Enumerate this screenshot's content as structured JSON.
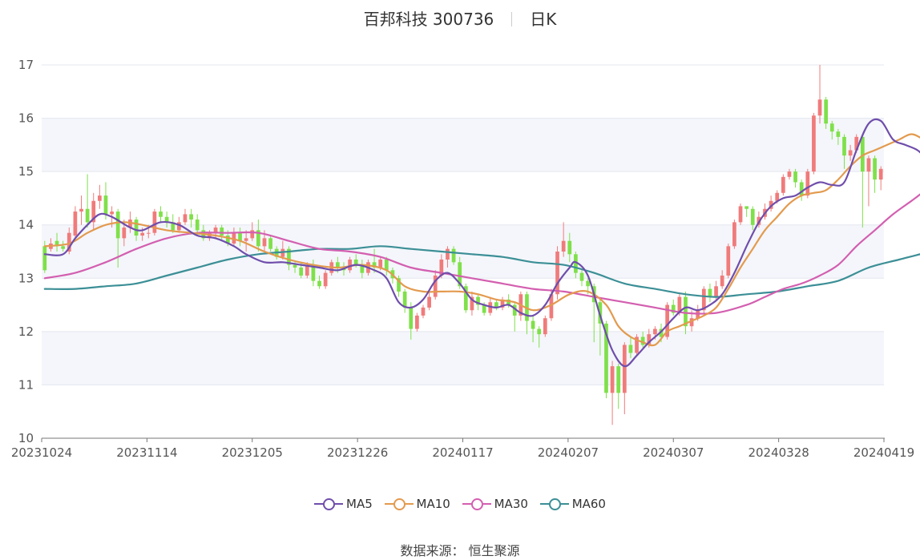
{
  "header": {
    "title": "百邦科技 300736",
    "period": "日K"
  },
  "footer": {
    "source": "数据来源： 恒生聚源"
  },
  "colors": {
    "up": "#f07b7b",
    "down": "#7fe04a",
    "grid": "#e3e7ef",
    "band": "#f4f6fb",
    "ma5": "#6f4eab",
    "ma10": "#e39a4e",
    "ma30": "#d35fb0",
    "ma60": "#3c8f96"
  },
  "chart_data": {
    "type": "candlestick",
    "ylim": [
      10,
      17
    ],
    "yticks": [
      "10",
      "11",
      "12",
      "13",
      "14",
      "15",
      "16",
      "17"
    ],
    "xtick_labels": [
      "20231024",
      "20231114",
      "20231205",
      "20231226",
      "20240117",
      "20240207",
      "20240307",
      "20240328",
      "20240419"
    ],
    "legend": [
      "MA5",
      "MA10",
      "MA30",
      "MA60"
    ],
    "candles": [
      [
        13.6,
        13.15,
        13.7,
        13.1
      ],
      [
        13.55,
        13.65,
        13.75,
        13.5
      ],
      [
        13.7,
        13.6,
        13.85,
        13.5
      ],
      [
        13.6,
        13.55,
        13.7,
        13.5
      ],
      [
        13.5,
        13.85,
        13.95,
        13.45
      ],
      [
        13.8,
        14.25,
        14.35,
        13.7
      ],
      [
        14.25,
        14.3,
        14.55,
        14.0
      ],
      [
        14.3,
        14.05,
        14.95,
        13.95
      ],
      [
        14.05,
        14.45,
        14.6,
        13.9
      ],
      [
        14.45,
        14.55,
        14.75,
        14.3
      ],
      [
        14.55,
        14.2,
        14.8,
        14.1
      ],
      [
        14.2,
        14.25,
        14.35,
        13.95
      ],
      [
        14.25,
        13.75,
        14.3,
        13.2
      ],
      [
        13.75,
        13.95,
        14.1,
        13.6
      ],
      [
        13.95,
        14.1,
        14.25,
        13.85
      ],
      [
        14.1,
        13.8,
        14.15,
        13.7
      ],
      [
        13.8,
        13.85,
        13.95,
        13.7
      ],
      [
        13.85,
        13.85,
        14.0,
        13.75
      ],
      [
        13.85,
        14.25,
        14.3,
        13.8
      ],
      [
        14.25,
        14.15,
        14.35,
        14.05
      ],
      [
        14.15,
        14.05,
        14.25,
        13.95
      ],
      [
        14.05,
        13.9,
        14.2,
        13.85
      ],
      [
        13.9,
        14.05,
        14.15,
        13.85
      ],
      [
        14.05,
        14.2,
        14.3,
        14.0
      ],
      [
        14.2,
        14.1,
        14.3,
        13.95
      ],
      [
        14.1,
        13.9,
        14.2,
        13.8
      ],
      [
        13.9,
        13.75,
        14.0,
        13.7
      ],
      [
        13.75,
        13.85,
        13.9,
        13.7
      ],
      [
        13.85,
        13.95,
        14.0,
        13.75
      ],
      [
        13.95,
        13.8,
        14.0,
        13.7
      ],
      [
        13.8,
        13.65,
        13.9,
        13.6
      ],
      [
        13.65,
        13.85,
        13.95,
        13.6
      ],
      [
        13.85,
        13.7,
        13.95,
        13.6
      ],
      [
        13.7,
        13.75,
        13.9,
        13.5
      ],
      [
        13.75,
        13.9,
        14.05,
        13.7
      ],
      [
        13.9,
        13.6,
        14.1,
        13.5
      ],
      [
        13.6,
        13.75,
        13.9,
        13.5
      ],
      [
        13.75,
        13.55,
        13.8,
        13.5
      ],
      [
        13.55,
        13.4,
        13.6,
        13.35
      ],
      [
        13.4,
        13.55,
        13.7,
        13.35
      ],
      [
        13.55,
        13.25,
        13.6,
        13.15
      ],
      [
        13.25,
        13.2,
        13.3,
        13.1
      ],
      [
        13.2,
        13.05,
        13.3,
        13.0
      ],
      [
        13.05,
        13.25,
        13.3,
        13.0
      ],
      [
        13.25,
        12.95,
        13.35,
        12.85
      ],
      [
        12.95,
        12.85,
        13.05,
        12.8
      ],
      [
        12.85,
        13.1,
        13.15,
        12.8
      ],
      [
        13.1,
        13.3,
        13.35,
        13.05
      ],
      [
        13.3,
        13.2,
        13.4,
        13.1
      ],
      [
        13.2,
        13.15,
        13.3,
        13.05
      ],
      [
        13.15,
        13.35,
        13.4,
        13.1
      ],
      [
        13.35,
        13.25,
        13.45,
        13.2
      ],
      [
        13.25,
        13.1,
        13.35,
        13.0
      ],
      [
        13.1,
        13.3,
        13.35,
        13.05
      ],
      [
        13.3,
        13.2,
        13.55,
        13.1
      ],
      [
        13.2,
        13.35,
        13.4,
        13.15
      ],
      [
        13.35,
        13.15,
        13.4,
        13.05
      ],
      [
        13.15,
        13.0,
        13.2,
        12.9
      ],
      [
        13.0,
        12.75,
        13.05,
        12.65
      ],
      [
        12.75,
        12.45,
        12.8,
        12.35
      ],
      [
        12.45,
        12.05,
        12.55,
        11.85
      ],
      [
        12.05,
        12.3,
        12.35,
        12.0
      ],
      [
        12.3,
        12.45,
        12.5,
        12.25
      ],
      [
        12.45,
        12.65,
        12.8,
        12.4
      ],
      [
        12.65,
        13.05,
        13.15,
        12.6
      ],
      [
        13.05,
        13.35,
        13.45,
        13.0
      ],
      [
        13.35,
        13.55,
        13.6,
        13.2
      ],
      [
        13.55,
        13.3,
        13.6,
        13.25
      ],
      [
        13.3,
        12.85,
        13.4,
        12.8
      ],
      [
        12.85,
        12.4,
        12.9,
        12.35
      ],
      [
        12.4,
        12.65,
        12.75,
        12.3
      ],
      [
        12.65,
        12.5,
        12.7,
        12.4
      ],
      [
        12.5,
        12.35,
        12.55,
        12.3
      ],
      [
        12.35,
        12.55,
        12.65,
        12.3
      ],
      [
        12.55,
        12.45,
        12.6,
        12.4
      ],
      [
        12.45,
        12.6,
        12.65,
        12.4
      ],
      [
        12.6,
        12.5,
        12.7,
        12.45
      ],
      [
        12.5,
        12.3,
        12.55,
        12.0
      ],
      [
        12.3,
        12.7,
        12.75,
        12.2
      ],
      [
        12.7,
        12.2,
        12.75,
        11.95
      ],
      [
        12.2,
        12.05,
        12.3,
        11.8
      ],
      [
        12.05,
        11.95,
        12.1,
        11.7
      ],
      [
        11.95,
        12.25,
        12.3,
        11.9
      ],
      [
        12.25,
        12.7,
        12.8,
        12.2
      ],
      [
        12.7,
        13.5,
        13.6,
        12.6
      ],
      [
        13.5,
        13.7,
        14.05,
        13.4
      ],
      [
        13.7,
        13.45,
        13.85,
        13.3
      ],
      [
        13.45,
        13.1,
        13.5,
        13.0
      ],
      [
        13.1,
        12.95,
        13.15,
        12.85
      ],
      [
        12.95,
        12.85,
        13.0,
        12.7
      ],
      [
        12.85,
        12.55,
        12.9,
        11.8
      ],
      [
        12.55,
        12.15,
        12.6,
        11.55
      ],
      [
        12.15,
        10.85,
        12.2,
        10.75
      ],
      [
        10.85,
        11.35,
        11.45,
        10.25
      ],
      [
        11.35,
        10.85,
        11.4,
        10.55
      ],
      [
        10.85,
        11.75,
        11.8,
        10.45
      ],
      [
        11.75,
        11.6,
        11.9,
        11.5
      ],
      [
        11.6,
        11.9,
        11.95,
        11.55
      ],
      [
        11.9,
        11.75,
        12.0,
        11.7
      ],
      [
        11.75,
        11.95,
        12.05,
        11.7
      ],
      [
        11.95,
        12.05,
        12.1,
        11.85
      ],
      [
        12.05,
        11.9,
        12.15,
        11.8
      ],
      [
        11.9,
        12.5,
        12.55,
        11.85
      ],
      [
        12.5,
        12.35,
        12.6,
        12.3
      ],
      [
        12.35,
        12.65,
        12.7,
        12.3
      ],
      [
        12.65,
        12.1,
        12.75,
        11.95
      ],
      [
        12.1,
        12.25,
        12.4,
        12.0
      ],
      [
        12.25,
        12.4,
        12.5,
        12.2
      ],
      [
        12.4,
        12.8,
        12.85,
        12.35
      ],
      [
        12.8,
        12.65,
        12.9,
        12.55
      ],
      [
        12.65,
        12.85,
        12.95,
        12.6
      ],
      [
        12.85,
        13.05,
        13.15,
        12.8
      ],
      [
        13.05,
        13.6,
        13.65,
        13.0
      ],
      [
        13.6,
        14.05,
        14.1,
        13.55
      ],
      [
        14.05,
        14.35,
        14.4,
        14.0
      ],
      [
        14.35,
        14.3,
        14.35,
        14.15
      ],
      [
        14.3,
        14.0,
        14.35,
        13.9
      ],
      [
        14.0,
        14.15,
        14.25,
        13.95
      ],
      [
        14.15,
        14.3,
        14.4,
        14.1
      ],
      [
        14.3,
        14.45,
        14.55,
        14.25
      ],
      [
        14.45,
        14.6,
        14.65,
        14.4
      ],
      [
        14.6,
        14.9,
        14.95,
        14.55
      ],
      [
        14.9,
        15.0,
        15.05,
        14.85
      ],
      [
        15.0,
        14.8,
        15.05,
        14.7
      ],
      [
        14.8,
        14.55,
        14.85,
        14.45
      ],
      [
        14.55,
        15.0,
        15.05,
        14.5
      ],
      [
        15.0,
        16.05,
        16.1,
        14.95
      ],
      [
        16.05,
        16.35,
        17.0,
        15.9
      ],
      [
        16.35,
        15.9,
        16.4,
        15.8
      ],
      [
        15.9,
        15.75,
        15.95,
        15.6
      ],
      [
        15.75,
        15.65,
        15.8,
        15.5
      ],
      [
        15.65,
        15.3,
        15.7,
        15.05
      ],
      [
        15.3,
        15.4,
        15.5,
        15.2
      ],
      [
        15.4,
        15.65,
        15.7,
        15.35
      ],
      [
        15.65,
        15.0,
        15.7,
        13.95
      ],
      [
        15.0,
        15.25,
        15.3,
        14.35
      ],
      [
        15.25,
        14.85,
        15.3,
        14.6
      ],
      [
        14.85,
        15.05,
        15.1,
        14.65
      ]
    ],
    "ma5": [
      [
        0,
        13.45
      ],
      [
        3,
        13.45
      ],
      [
        5,
        13.75
      ],
      [
        7,
        14.0
      ],
      [
        9,
        14.2
      ],
      [
        11,
        14.15
      ],
      [
        14,
        13.95
      ],
      [
        16,
        13.9
      ],
      [
        19,
        14.05
      ],
      [
        22,
        14.0
      ],
      [
        25,
        13.8
      ],
      [
        28,
        13.75
      ],
      [
        31,
        13.6
      ],
      [
        33,
        13.45
      ],
      [
        36,
        13.3
      ],
      [
        39,
        13.3
      ],
      [
        42,
        13.25
      ],
      [
        45,
        13.2
      ],
      [
        48,
        13.15
      ],
      [
        51,
        13.25
      ],
      [
        54,
        13.15
      ],
      [
        56,
        13.0
      ],
      [
        58,
        12.55
      ],
      [
        60,
        12.45
      ],
      [
        62,
        12.6
      ],
      [
        64,
        12.95
      ],
      [
        66,
        13.1
      ],
      [
        68,
        12.9
      ],
      [
        70,
        12.6
      ],
      [
        72,
        12.5
      ],
      [
        74,
        12.45
      ],
      [
        76,
        12.5
      ],
      [
        78,
        12.35
      ],
      [
        80,
        12.3
      ],
      [
        82,
        12.5
      ],
      [
        84,
        12.9
      ],
      [
        86,
        13.2
      ],
      [
        87,
        13.3
      ],
      [
        89,
        13.05
      ],
      [
        91,
        12.3
      ],
      [
        93,
        11.65
      ],
      [
        95,
        11.35
      ],
      [
        97,
        11.55
      ],
      [
        99,
        11.8
      ],
      [
        101,
        12.0
      ],
      [
        103,
        12.25
      ],
      [
        105,
        12.45
      ],
      [
        107,
        12.4
      ],
      [
        109,
        12.5
      ],
      [
        111,
        12.7
      ],
      [
        113,
        13.1
      ],
      [
        115,
        13.6
      ],
      [
        117,
        14.05
      ],
      [
        119,
        14.35
      ],
      [
        121,
        14.5
      ],
      [
        123,
        14.55
      ],
      [
        125,
        14.7
      ],
      [
        127,
        14.8
      ],
      [
        129,
        14.75
      ],
      [
        131,
        14.8
      ],
      [
        133,
        15.4
      ],
      [
        135,
        15.9
      ],
      [
        137,
        15.95
      ],
      [
        139,
        15.6
      ],
      [
        141,
        15.5
      ],
      [
        143,
        15.4
      ],
      [
        145,
        15.2
      ],
      [
        147,
        15.15
      ],
      [
        149,
        15.0
      ]
    ],
    "ma10": [
      [
        0,
        13.6
      ],
      [
        4,
        13.65
      ],
      [
        7,
        13.85
      ],
      [
        10,
        14.0
      ],
      [
        13,
        14.05
      ],
      [
        16,
        14.0
      ],
      [
        20,
        13.9
      ],
      [
        24,
        13.85
      ],
      [
        28,
        13.8
      ],
      [
        32,
        13.7
      ],
      [
        36,
        13.5
      ],
      [
        40,
        13.35
      ],
      [
        44,
        13.25
      ],
      [
        48,
        13.2
      ],
      [
        52,
        13.25
      ],
      [
        56,
        13.15
      ],
      [
        59,
        12.85
      ],
      [
        62,
        12.75
      ],
      [
        65,
        12.75
      ],
      [
        68,
        12.75
      ],
      [
        71,
        12.7
      ],
      [
        74,
        12.6
      ],
      [
        77,
        12.55
      ],
      [
        80,
        12.4
      ],
      [
        83,
        12.5
      ],
      [
        86,
        12.7
      ],
      [
        89,
        12.75
      ],
      [
        92,
        12.5
      ],
      [
        94,
        12.1
      ],
      [
        96,
        11.9
      ],
      [
        98,
        11.8
      ],
      [
        100,
        11.75
      ],
      [
        102,
        12.0
      ],
      [
        104,
        12.1
      ],
      [
        106,
        12.2
      ],
      [
        108,
        12.3
      ],
      [
        110,
        12.45
      ],
      [
        112,
        12.8
      ],
      [
        114,
        13.2
      ],
      [
        116,
        13.55
      ],
      [
        118,
        13.9
      ],
      [
        120,
        14.15
      ],
      [
        122,
        14.4
      ],
      [
        124,
        14.55
      ],
      [
        126,
        14.6
      ],
      [
        128,
        14.65
      ],
      [
        130,
        14.85
      ],
      [
        132,
        15.1
      ],
      [
        134,
        15.3
      ],
      [
        136,
        15.4
      ],
      [
        138,
        15.5
      ],
      [
        140,
        15.6
      ],
      [
        142,
        15.7
      ],
      [
        144,
        15.6
      ],
      [
        146,
        15.45
      ],
      [
        148,
        15.3
      ],
      [
        149,
        15.25
      ]
    ],
    "ma30": [
      [
        0,
        13.0
      ],
      [
        5,
        13.1
      ],
      [
        10,
        13.3
      ],
      [
        15,
        13.55
      ],
      [
        20,
        13.75
      ],
      [
        25,
        13.85
      ],
      [
        30,
        13.85
      ],
      [
        35,
        13.85
      ],
      [
        40,
        13.7
      ],
      [
        45,
        13.55
      ],
      [
        50,
        13.5
      ],
      [
        55,
        13.4
      ],
      [
        60,
        13.2
      ],
      [
        65,
        13.1
      ],
      [
        70,
        13.0
      ],
      [
        75,
        12.9
      ],
      [
        80,
        12.8
      ],
      [
        85,
        12.75
      ],
      [
        90,
        12.65
      ],
      [
        95,
        12.55
      ],
      [
        100,
        12.45
      ],
      [
        105,
        12.35
      ],
      [
        110,
        12.35
      ],
      [
        115,
        12.5
      ],
      [
        118,
        12.65
      ],
      [
        121,
        12.8
      ],
      [
        124,
        12.9
      ],
      [
        127,
        13.05
      ],
      [
        130,
        13.25
      ],
      [
        133,
        13.6
      ],
      [
        136,
        13.9
      ],
      [
        139,
        14.2
      ],
      [
        142,
        14.45
      ],
      [
        145,
        14.7
      ],
      [
        148,
        14.9
      ],
      [
        149,
        14.95
      ]
    ],
    "ma60": [
      [
        0,
        12.8
      ],
      [
        5,
        12.8
      ],
      [
        10,
        12.85
      ],
      [
        15,
        12.9
      ],
      [
        20,
        13.05
      ],
      [
        25,
        13.2
      ],
      [
        30,
        13.35
      ],
      [
        35,
        13.45
      ],
      [
        40,
        13.5
      ],
      [
        45,
        13.55
      ],
      [
        50,
        13.55
      ],
      [
        55,
        13.6
      ],
      [
        60,
        13.55
      ],
      [
        65,
        13.5
      ],
      [
        70,
        13.45
      ],
      [
        75,
        13.4
      ],
      [
        80,
        13.3
      ],
      [
        85,
        13.25
      ],
      [
        90,
        13.1
      ],
      [
        95,
        12.9
      ],
      [
        100,
        12.8
      ],
      [
        105,
        12.7
      ],
      [
        110,
        12.65
      ],
      [
        115,
        12.7
      ],
      [
        120,
        12.75
      ],
      [
        125,
        12.85
      ],
      [
        130,
        12.95
      ],
      [
        135,
        13.2
      ],
      [
        140,
        13.35
      ],
      [
        145,
        13.5
      ],
      [
        149,
        13.65
      ]
    ]
  }
}
